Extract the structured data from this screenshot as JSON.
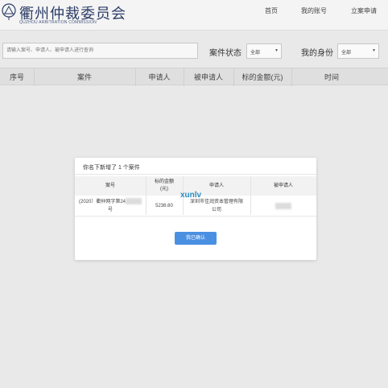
{
  "header": {
    "title": "衢州仲裁委员会",
    "subtitle": "QUZHOU ARBITRATION COMMISSION",
    "nav": [
      "首页",
      "我的账号",
      "立案申请"
    ]
  },
  "filters": {
    "search_placeholder": "请输入案号、申请人、被申请人进行查询",
    "case_status_label": "案件状态",
    "case_status_value": "全部",
    "identity_label": "我的身份",
    "identity_value": "全部"
  },
  "table": {
    "columns": [
      "序号",
      "案件",
      "申请人",
      "被申请人",
      "标的金额(元)",
      "时间"
    ]
  },
  "modal": {
    "title": "你名下新增了 1 个案件",
    "columns": [
      "案号",
      "标的金额\n(元)",
      "申请人",
      "被申请人"
    ],
    "row": {
      "case_no": "(2020）衢仲网字第24",
      "case_no_suffix": "号",
      "amount": "5236.60",
      "applicant": "深圳市佳润资本管理有限\n公司",
      "respondent": ""
    },
    "watermark": "xunlv",
    "confirm_label": "我已确认"
  },
  "colors": {
    "brand": "#2a3b66",
    "button": "#4a90e2",
    "overlay": "#e9e9e9"
  }
}
